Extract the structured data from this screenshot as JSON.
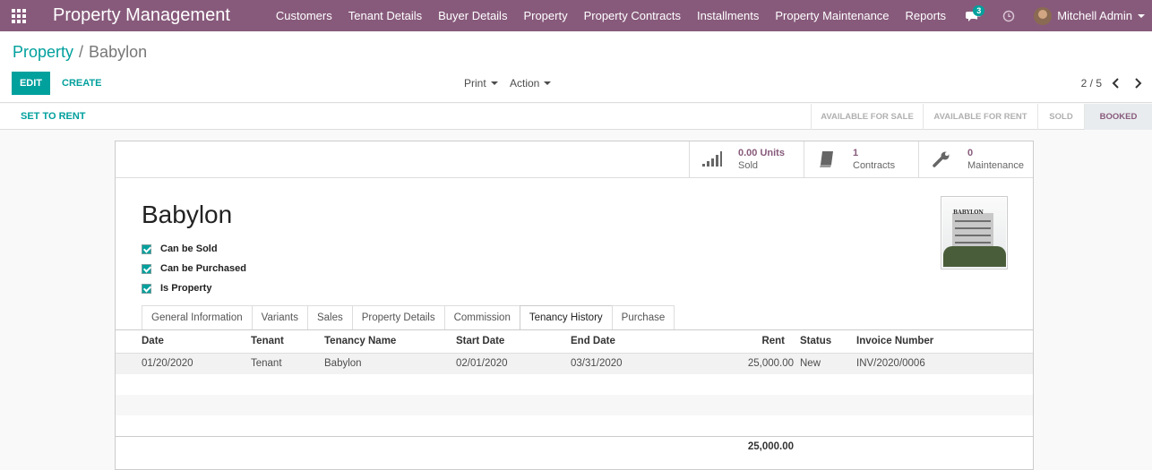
{
  "navbar": {
    "app_title": "Property Management",
    "menu": [
      "Customers",
      "Tenant Details",
      "Buyer Details",
      "Property",
      "Property Contracts",
      "Installments",
      "Property Maintenance",
      "Reports"
    ],
    "plus": "+",
    "chat_count": "3",
    "user_name": "Mitchell Admin",
    "bg_color": "#875a7b"
  },
  "breadcrumb": {
    "parent": "Property",
    "separator": "/",
    "current": "Babylon"
  },
  "actions": {
    "edit": "EDIT",
    "create": "CREATE",
    "print": "Print",
    "action": "Action"
  },
  "pager": {
    "value": "2 / 5"
  },
  "header": {
    "set_to_rent": "SET TO RENT",
    "stages": [
      "AVAILABLE FOR SALE",
      "AVAILABLE FOR RENT",
      "SOLD",
      "BOOKED"
    ],
    "active_stage": "BOOKED"
  },
  "stat_buttons": {
    "sold": {
      "value": "0.00 Units",
      "label": "Sold",
      "icon": "signal-bars-icon"
    },
    "contracts": {
      "value": "1",
      "label": "Contracts",
      "icon": "book-icon"
    },
    "maintenance": {
      "value": "0",
      "label": "Maintenance",
      "icon": "wrench-icon"
    }
  },
  "record": {
    "name": "Babylon",
    "checkboxes": [
      {
        "label": "Can be Sold",
        "checked": true
      },
      {
        "label": "Can be Purchased",
        "checked": true
      },
      {
        "label": "Is Property",
        "checked": true
      }
    ],
    "image_logo_text": "BABYLON"
  },
  "tabs": [
    "General Information",
    "Variants",
    "Sales",
    "Property Details",
    "Commission",
    "Tenancy History",
    "Purchase"
  ],
  "active_tab": "Tenancy History",
  "table": {
    "columns": [
      "Date",
      "Tenant",
      "Tenancy Name",
      "Start Date",
      "End Date",
      "Rent",
      "Status",
      "Invoice Number"
    ],
    "rows": [
      {
        "date": "01/20/2020",
        "tenant": "Tenant",
        "tenancy_name": "Babylon",
        "start_date": "02/01/2020",
        "end_date": "03/31/2020",
        "rent": "25,000.00",
        "status": "New",
        "invoice": "INV/2020/0006"
      }
    ],
    "total_rent": "25,000.00"
  },
  "colors": {
    "accent": "#00a09d",
    "brand": "#875a7b"
  }
}
